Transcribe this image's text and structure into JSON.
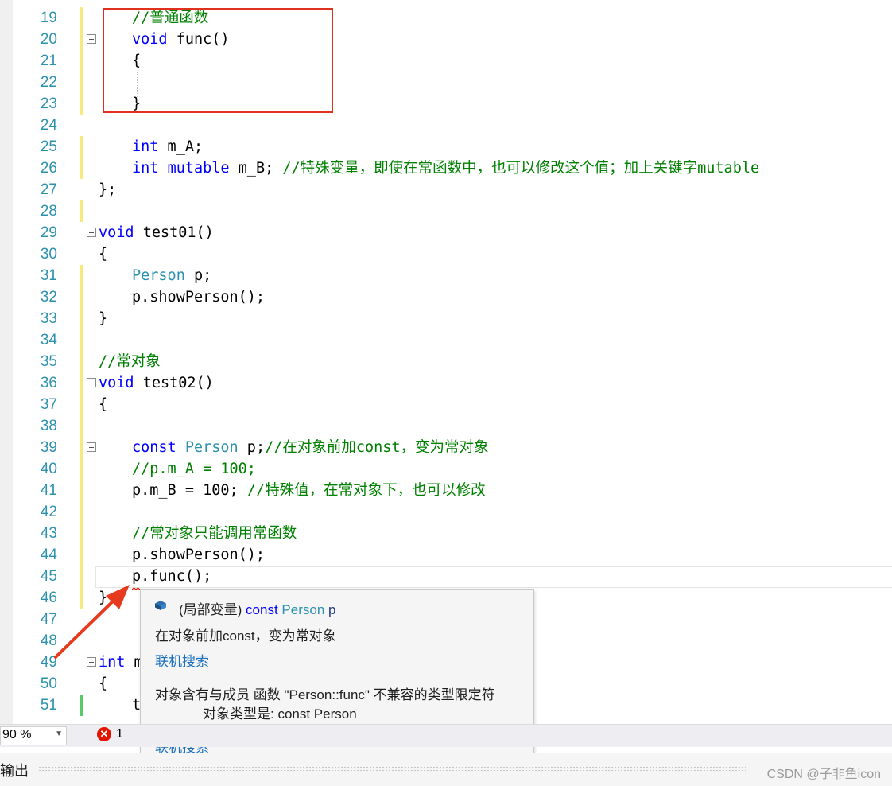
{
  "editor": {
    "lines": [
      {
        "n": "19",
        "chg": "yellow",
        "fold": false,
        "indent": 2,
        "tokens": [
          {
            "c": "cm",
            "t": "//普通函数"
          }
        ]
      },
      {
        "n": "20",
        "chg": "yellow",
        "fold": true,
        "indent": 2,
        "tokens": [
          {
            "c": "kw",
            "t": "void"
          },
          {
            "c": "nm",
            "t": " func()"
          }
        ]
      },
      {
        "n": "21",
        "chg": "yellow",
        "fold": false,
        "indent": 2,
        "tokens": [
          {
            "c": "nm",
            "t": "{"
          }
        ]
      },
      {
        "n": "22",
        "chg": "yellow",
        "fold": false,
        "indent": 2,
        "tokens": []
      },
      {
        "n": "23",
        "chg": "yellow",
        "fold": false,
        "indent": 2,
        "tokens": [
          {
            "c": "nm",
            "t": "}"
          }
        ]
      },
      {
        "n": "24",
        "chg": "",
        "fold": false,
        "indent": 2,
        "tokens": []
      },
      {
        "n": "25",
        "chg": "yellow",
        "fold": false,
        "indent": 2,
        "tokens": [
          {
            "c": "kw",
            "t": "int"
          },
          {
            "c": "nm",
            "t": " m_A;"
          }
        ]
      },
      {
        "n": "26",
        "chg": "yellow",
        "fold": false,
        "indent": 2,
        "tokens": [
          {
            "c": "kw",
            "t": "int"
          },
          {
            "c": "nm",
            "t": " "
          },
          {
            "c": "kw",
            "t": "mutable"
          },
          {
            "c": "nm",
            "t": " m_B; "
          },
          {
            "c": "cm",
            "t": "//特殊变量，即使在常函数中，也可以修改这个值；加上关键字mutable"
          }
        ]
      },
      {
        "n": "27",
        "chg": "",
        "fold": false,
        "indent": 1,
        "tokens": [
          {
            "c": "nm",
            "t": "};"
          }
        ]
      },
      {
        "n": "28",
        "chg": "yellow",
        "fold": false,
        "indent": 0,
        "tokens": []
      },
      {
        "n": "29",
        "chg": "",
        "fold": true,
        "indent": 1,
        "tokens": [
          {
            "c": "kw",
            "t": "void"
          },
          {
            "c": "nm",
            "t": " test01()"
          }
        ]
      },
      {
        "n": "30",
        "chg": "",
        "fold": false,
        "indent": 1,
        "tokens": [
          {
            "c": "nm",
            "t": "{"
          }
        ]
      },
      {
        "n": "31",
        "chg": "yellow",
        "fold": false,
        "indent": 2,
        "tokens": [
          {
            "c": "ty",
            "t": "Person"
          },
          {
            "c": "nm",
            "t": " p;"
          }
        ]
      },
      {
        "n": "32",
        "chg": "yellow",
        "fold": false,
        "indent": 2,
        "tokens": [
          {
            "c": "nm",
            "t": "p.showPerson();"
          }
        ]
      },
      {
        "n": "33",
        "chg": "yellow",
        "fold": false,
        "indent": 1,
        "tokens": [
          {
            "c": "nm",
            "t": "}"
          }
        ]
      },
      {
        "n": "34",
        "chg": "yellow",
        "fold": false,
        "indent": 0,
        "tokens": []
      },
      {
        "n": "35",
        "chg": "yellow",
        "fold": false,
        "indent": 1,
        "tokens": [
          {
            "c": "cm",
            "t": "//常对象"
          }
        ]
      },
      {
        "n": "36",
        "chg": "yellow",
        "fold": true,
        "indent": 1,
        "tokens": [
          {
            "c": "kw",
            "t": "void"
          },
          {
            "c": "nm",
            "t": " test02()"
          }
        ]
      },
      {
        "n": "37",
        "chg": "yellow",
        "fold": false,
        "indent": 1,
        "tokens": [
          {
            "c": "nm",
            "t": "{"
          }
        ]
      },
      {
        "n": "38",
        "chg": "yellow",
        "fold": false,
        "indent": 2,
        "tokens": []
      },
      {
        "n": "39",
        "chg": "yellow",
        "fold": true,
        "indent": 2,
        "tokens": [
          {
            "c": "kw",
            "t": "const"
          },
          {
            "c": "nm",
            "t": " "
          },
          {
            "c": "ty",
            "t": "Person"
          },
          {
            "c": "nm",
            "t": " p;"
          },
          {
            "c": "cm",
            "t": "//在对象前加const，变为常对象"
          }
        ]
      },
      {
        "n": "40",
        "chg": "yellow",
        "fold": false,
        "indent": 2,
        "tokens": [
          {
            "c": "cm",
            "t": "//p.m_A = 100;"
          }
        ]
      },
      {
        "n": "41",
        "chg": "yellow",
        "fold": false,
        "indent": 2,
        "tokens": [
          {
            "c": "nm",
            "t": "p.m_B = 100; "
          },
          {
            "c": "cm",
            "t": "//特殊值，在常对象下，也可以修改"
          }
        ]
      },
      {
        "n": "42",
        "chg": "yellow",
        "fold": false,
        "indent": 2,
        "tokens": []
      },
      {
        "n": "43",
        "chg": "yellow",
        "fold": false,
        "indent": 2,
        "tokens": [
          {
            "c": "cm",
            "t": "//常对象只能调用常函数"
          }
        ]
      },
      {
        "n": "44",
        "chg": "yellow",
        "fold": false,
        "indent": 2,
        "tokens": [
          {
            "c": "nm",
            "t": "p.showPerson();"
          }
        ]
      },
      {
        "n": "45",
        "chg": "yellow",
        "fold": false,
        "indent": 2,
        "tokens": [
          {
            "c": "nm",
            "t": "p.func();"
          }
        ]
      },
      {
        "n": "46",
        "chg": "yellow",
        "fold": false,
        "indent": 1,
        "tokens": [
          {
            "c": "nm",
            "t": "}"
          }
        ]
      },
      {
        "n": "47",
        "chg": "",
        "fold": false,
        "indent": 0,
        "tokens": []
      },
      {
        "n": "48",
        "chg": "",
        "fold": false,
        "indent": 0,
        "tokens": []
      },
      {
        "n": "49",
        "chg": "",
        "fold": true,
        "indent": 1,
        "tokens": [
          {
            "c": "kw",
            "t": "int"
          },
          {
            "c": "nm",
            "t": " m"
          }
        ]
      },
      {
        "n": "50",
        "chg": "",
        "fold": false,
        "indent": 1,
        "tokens": [
          {
            "c": "nm",
            "t": "{"
          }
        ]
      },
      {
        "n": "51",
        "chg": "green",
        "fold": false,
        "indent": 2,
        "tokens": [
          {
            "c": "nm",
            "t": "t"
          }
        ]
      }
    ]
  },
  "tooltip": {
    "header_prefix": "(局部变量) ",
    "header_kw": "const",
    "header_type": "Person",
    "header_var": "p",
    "comment": "在对象前加const，变为常对象",
    "search_link_1": "联机搜索",
    "error_line_1": "对象含有与成员 函数 \"Person::func\" 不兼容的类型限定符",
    "error_line_2": "对象类型是:  const Person",
    "search_link_2": "联机搜索"
  },
  "status": {
    "zoom": "90 %",
    "error_count": "1",
    "error_icon": "x-circle-icon"
  },
  "output_panel": {
    "title": "输出",
    "watermark": "CSDN @子非鱼icon"
  },
  "colors": {
    "keyword": "#0000ff",
    "type": "#2b91af",
    "comment": "#008000",
    "highlight_box": "#e0301e",
    "change_bar": "#f5ea7a"
  }
}
